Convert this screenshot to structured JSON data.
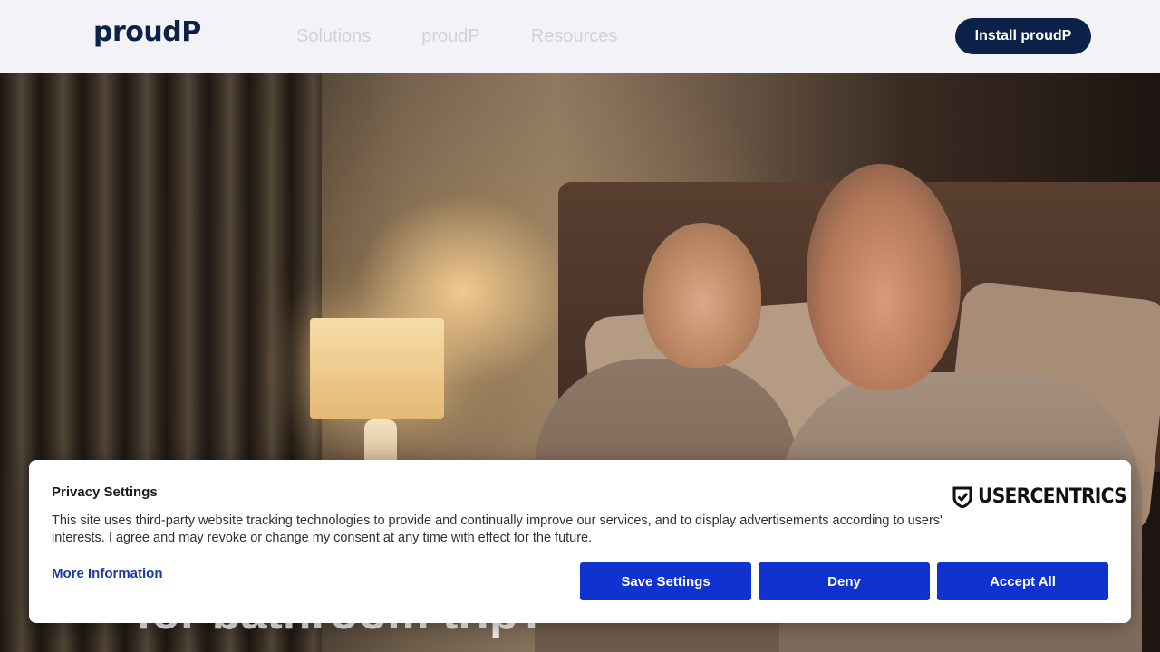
{
  "header": {
    "logo": "proudP",
    "nav": [
      "Solutions",
      "proudP",
      "Resources"
    ],
    "install_label": "Install proudP"
  },
  "hero": {
    "headline_partial": "for bathroom trip?"
  },
  "consent": {
    "title": "Privacy Settings",
    "body": "This site uses third-party website tracking technologies to provide and continually improve our services, and to display advertisements according to users' interests. I agree and may revoke or change my consent at any time with effect for the future.",
    "brand": "USERCENTRICS",
    "more_info": "More Information",
    "save_label": "Save Settings",
    "deny_label": "Deny",
    "accept_label": "Accept All"
  },
  "colors": {
    "navy": "#0c2148",
    "header_bg": "#f3f3f7",
    "nav_text": "#cfd2db",
    "consent_button": "#1032cf",
    "link": "#1b3a9e"
  }
}
